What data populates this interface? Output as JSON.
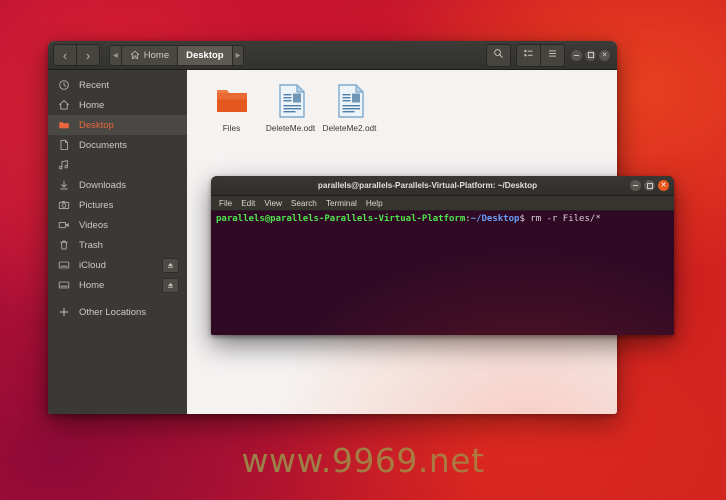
{
  "desktop": {
    "watermark": "www.9969.net",
    "background_color": "#c4152f"
  },
  "file_manager": {
    "nav": {
      "back_label": "‹",
      "forward_label": "›",
      "crumb_prev_label": "◂",
      "crumb_next_label": "▸",
      "breadcrumbs": [
        {
          "label": "Home",
          "icon": "home-icon",
          "active": false
        },
        {
          "label": "Desktop",
          "icon": "",
          "active": true
        }
      ]
    },
    "toolbar": {
      "search_icon": "search-icon",
      "list_view_icon": "list-view-icon",
      "menu_icon": "hamburger-menu-icon",
      "minimize_label": "–",
      "maximize_label": "□",
      "close_label": "✕"
    },
    "sidebar": {
      "items": [
        {
          "label": "Recent",
          "icon": "clock-icon",
          "selected": false,
          "eject": false
        },
        {
          "label": "Home",
          "icon": "home-icon",
          "selected": false,
          "eject": false
        },
        {
          "label": "Desktop",
          "icon": "folder-icon",
          "selected": true,
          "eject": false
        },
        {
          "label": "Documents",
          "icon": "document-icon",
          "selected": false,
          "eject": false
        },
        {
          "label": "",
          "icon": "music-icon",
          "selected": false,
          "eject": false
        },
        {
          "label": "Downloads",
          "icon": "download-icon",
          "selected": false,
          "eject": false
        },
        {
          "label": "Pictures",
          "icon": "camera-icon",
          "selected": false,
          "eject": false
        },
        {
          "label": "Videos",
          "icon": "video-icon",
          "selected": false,
          "eject": false
        },
        {
          "label": "Trash",
          "icon": "trash-icon",
          "selected": false,
          "eject": false
        },
        {
          "label": "iCloud",
          "icon": "drive-icon",
          "selected": false,
          "eject": true
        },
        {
          "label": "Home",
          "icon": "drive-icon",
          "selected": false,
          "eject": true
        },
        {
          "label": "Other Locations",
          "icon": "plus-icon",
          "selected": false,
          "eject": false
        }
      ]
    },
    "files": [
      {
        "name": "Files",
        "type": "folder"
      },
      {
        "name": "DeleteMe.odt",
        "type": "document"
      },
      {
        "name": "DeleteMe2.odt",
        "type": "document"
      }
    ]
  },
  "terminal": {
    "title": "parallels@parallels-Parallels-Virtual-Platform: ~/Desktop",
    "menu": [
      "File",
      "Edit",
      "View",
      "Search",
      "Terminal",
      "Help"
    ],
    "window_buttons": {
      "minimize_label": "–",
      "maximize_label": "□",
      "close_label": "✕"
    },
    "prompt": {
      "user_host": "parallels@parallels-Parallels-Virtual-Platform",
      "colon": ":",
      "path": "~/Desktop",
      "dollar": "$",
      "command": " rm -r Files/*"
    }
  }
}
